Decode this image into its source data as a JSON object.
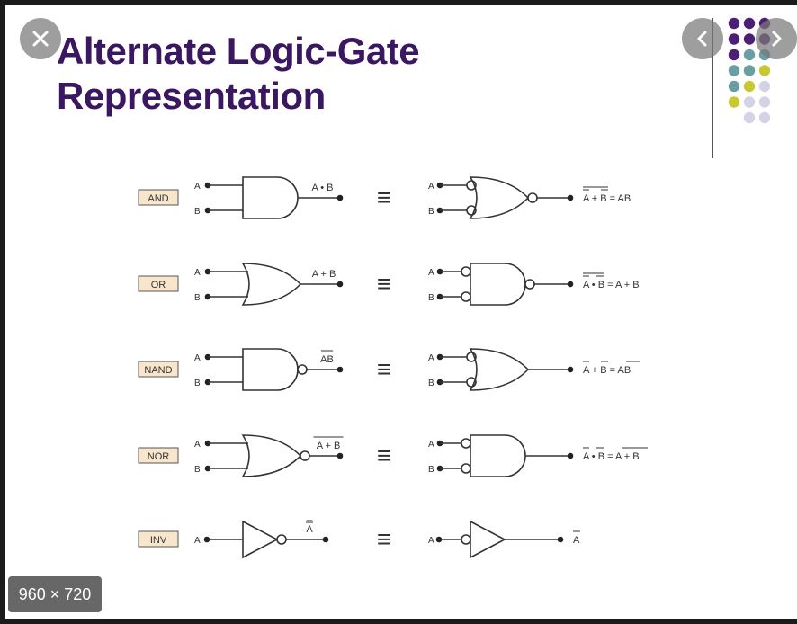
{
  "title_line1": "Alternate Logic-Gate",
  "title_line2": "Representation",
  "dimensions": "960 × 720",
  "icons": {
    "close": "close-icon",
    "prev": "chevron-left-icon",
    "next": "chevron-right-icon"
  },
  "colors": {
    "title": "#3a1760",
    "label_fill": "#f8e6cc",
    "dot_purple": "#4b1f73",
    "dot_teal": "#6b9ea2",
    "dot_yellow": "#c8c832",
    "dot_lavender": "#d4d2e6"
  },
  "equiv": "≡",
  "rows": [
    {
      "label": "AND",
      "left_output": "A • B",
      "right_output": "A + B = AB"
    },
    {
      "label": "OR",
      "left_output": "A + B",
      "right_output": "A • B = A + B"
    },
    {
      "label": "NAND",
      "left_output": "AB",
      "right_output": "A + B = AB"
    },
    {
      "label": "NOR",
      "left_output": "A + B",
      "right_output": "A • B = A + B"
    },
    {
      "label": "INV",
      "left_output": "A",
      "right_output": "A"
    }
  ],
  "input_a": "A",
  "input_b": "B"
}
